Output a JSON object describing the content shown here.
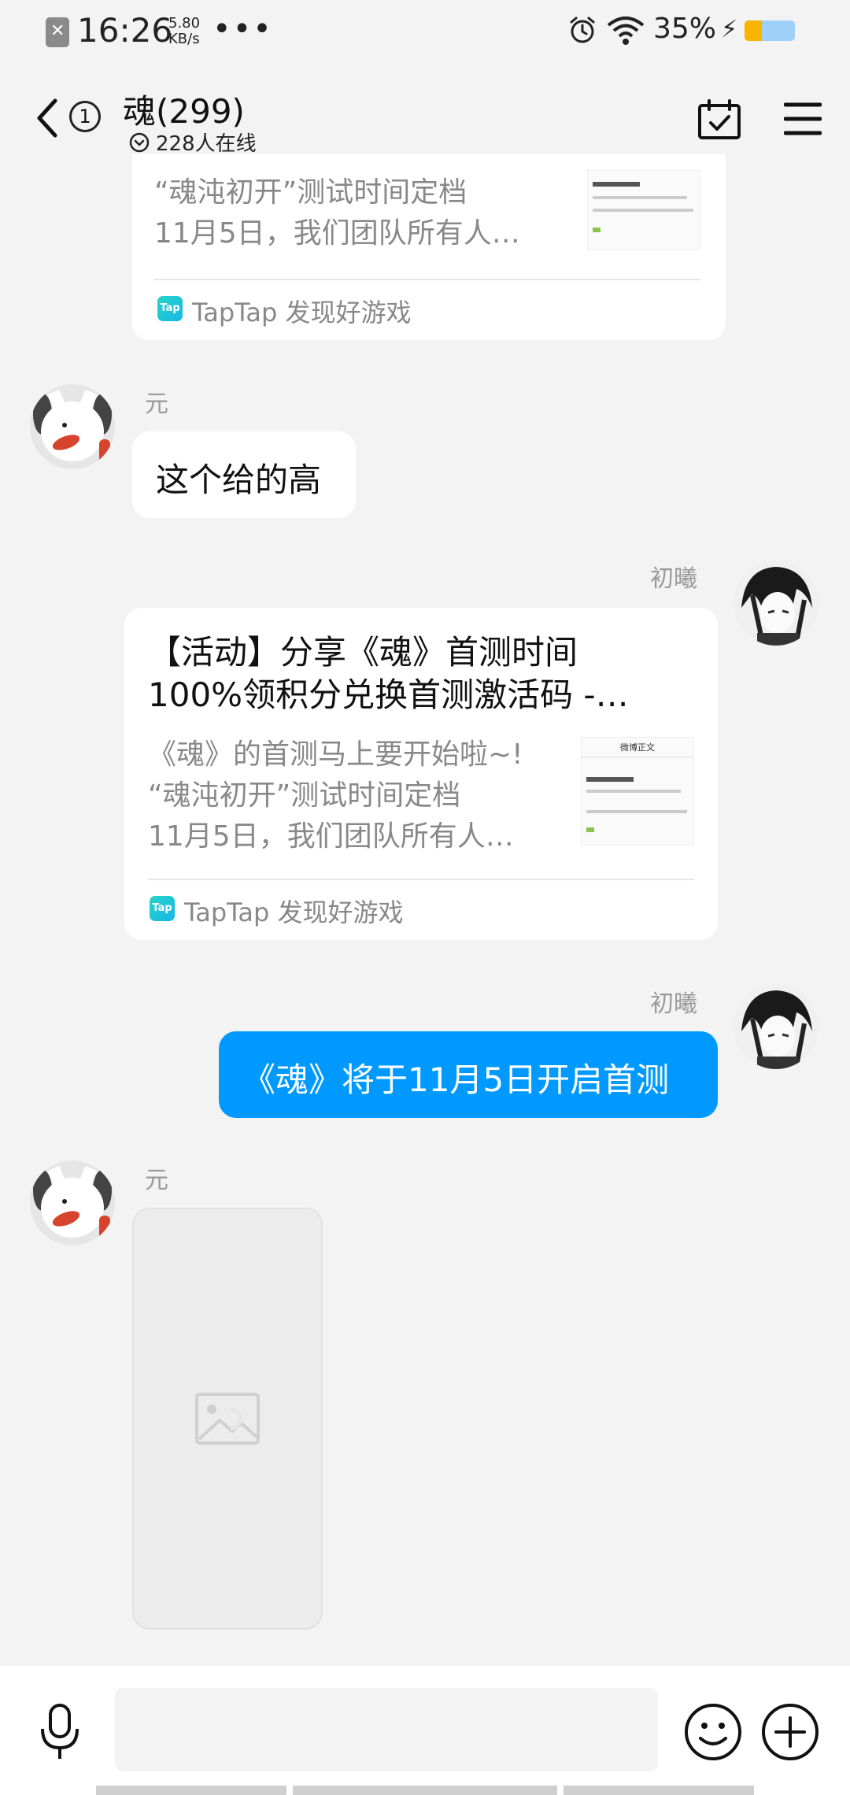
{
  "status_bar": {
    "time": "16:26",
    "net_speed": "5.80 KB/s",
    "dots": "•••",
    "battery_pct": "35%",
    "battery_level": 0.35,
    "icons": [
      "notification-off-icon",
      "alarm-icon",
      "wifi-icon",
      "charging-icon",
      "battery-icon"
    ]
  },
  "header": {
    "back_badge": "1",
    "title": "魂(299)",
    "online": "228人在线",
    "icons": [
      "back-icon",
      "calendar-check-icon",
      "menu-icon"
    ]
  },
  "messages": {
    "card_top": {
      "desc_line2": "“魂沌初开”测试时间定档",
      "desc_line3": "11月5日，我们团队所有人…",
      "source": "TapTap 发现好游戏",
      "logo_text": "Tap"
    },
    "msg_yuan_1": {
      "sender": "元",
      "text": "这个给的高"
    },
    "msg_chuxi_card": {
      "sender": "初曦",
      "title_line1": "【活动】分享《魂》首测时间",
      "title_line2": "100%领积分兑换首测激活码 -…",
      "desc_line1": "《魂》的首测马上要开始啦~!",
      "desc_line2": "“魂沌初开”测试时间定档",
      "desc_line3": "11月5日，我们团队所有人…",
      "source": "TapTap 发现好游戏",
      "logo_text": "Tap",
      "thumb_header": "微博正文"
    },
    "msg_chuxi_text": {
      "sender": "初曦",
      "text": "《魂》将于11月5日开启首测"
    },
    "msg_yuan_2": {
      "sender": "元"
    }
  },
  "bottom_bar": {
    "input_value": "",
    "icons": [
      "microphone-icon",
      "emoji-icon",
      "plus-icon"
    ]
  },
  "colors": {
    "accent_blue": "#0099ff",
    "background": "#f3f3f3"
  }
}
